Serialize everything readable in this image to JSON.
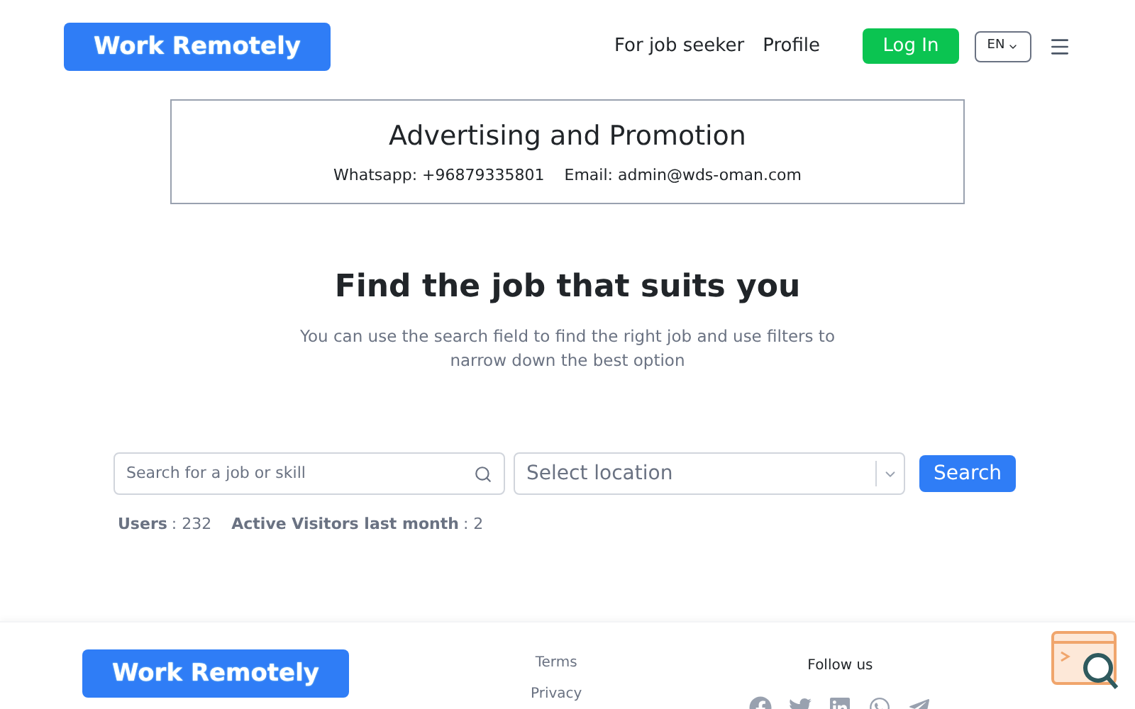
{
  "header": {
    "logo": "Work Remotely",
    "nav": [
      "For job seeker",
      "Profile"
    ],
    "login": "Log In",
    "language": "EN"
  },
  "promo": {
    "title": "Advertising and Promotion",
    "whatsapp": "Whatsapp: +96879335801",
    "email": "Email: admin@wds-oman.com"
  },
  "hero": {
    "title": "Find the job that suits you",
    "subtitle": "You can use the search field to find the right job and use filters to narrow down the best option"
  },
  "search": {
    "placeholder": "Search for a job or skill",
    "location_placeholder": "Select location",
    "button": "Search"
  },
  "stats": [
    {
      "label": "Users",
      "value": ": 232"
    },
    {
      "label": "Active Visitors last month",
      "value": ": 2"
    }
  ],
  "footer": {
    "logo": "Work Remotely",
    "links": [
      "Terms",
      "Privacy"
    ],
    "follow": "Follow us"
  }
}
